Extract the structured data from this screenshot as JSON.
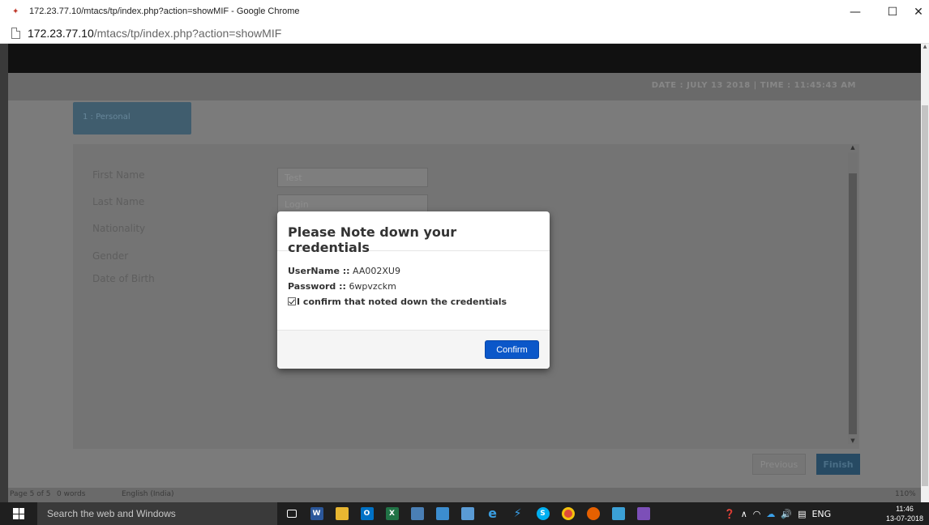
{
  "window": {
    "title": "172.23.77.10/mtacs/tp/index.php?action=showMIF - Google Chrome",
    "minimize_glyph": "—",
    "maximize_glyph": "☐",
    "close_glyph": "✕"
  },
  "address_bar": {
    "host": "172.23.77.10",
    "path": "/mtacs/tp/index.php?action=showMIF"
  },
  "page": {
    "datetime": "DATE : JULY 13 2018  |  TIME : 11:45:43 AM",
    "tab_label": "1 : Personal",
    "form_labels": [
      "First Name",
      "Last Name",
      "Nationality",
      "Gender",
      "Date of Birth"
    ],
    "first_name_value": "Test",
    "last_name_value": "Login",
    "previous_label": "Previous",
    "finish_label": "Finish",
    "word_status": {
      "page": "Page 5 of 5",
      "words": "0 words",
      "language": "English (India)",
      "zoom": "110%"
    }
  },
  "modal": {
    "title": "Please Note down your credentials",
    "username_label": "UserName ::",
    "username_value": "AA002XU9",
    "password_label": "Password ::",
    "password_value": "6wpvzckm",
    "confirm_text": "I confirm that noted down the credentials",
    "confirm_checked": true,
    "confirm_button": "Confirm"
  },
  "taskbar": {
    "search_placeholder": "Search the web and Windows",
    "language": "ENG",
    "time": "11:46",
    "date": "13-07-2018"
  },
  "colors": {
    "confirm_button": "#0b57c9",
    "overlay": "#7b7b7b",
    "taskbar": "#1f1f1f"
  }
}
